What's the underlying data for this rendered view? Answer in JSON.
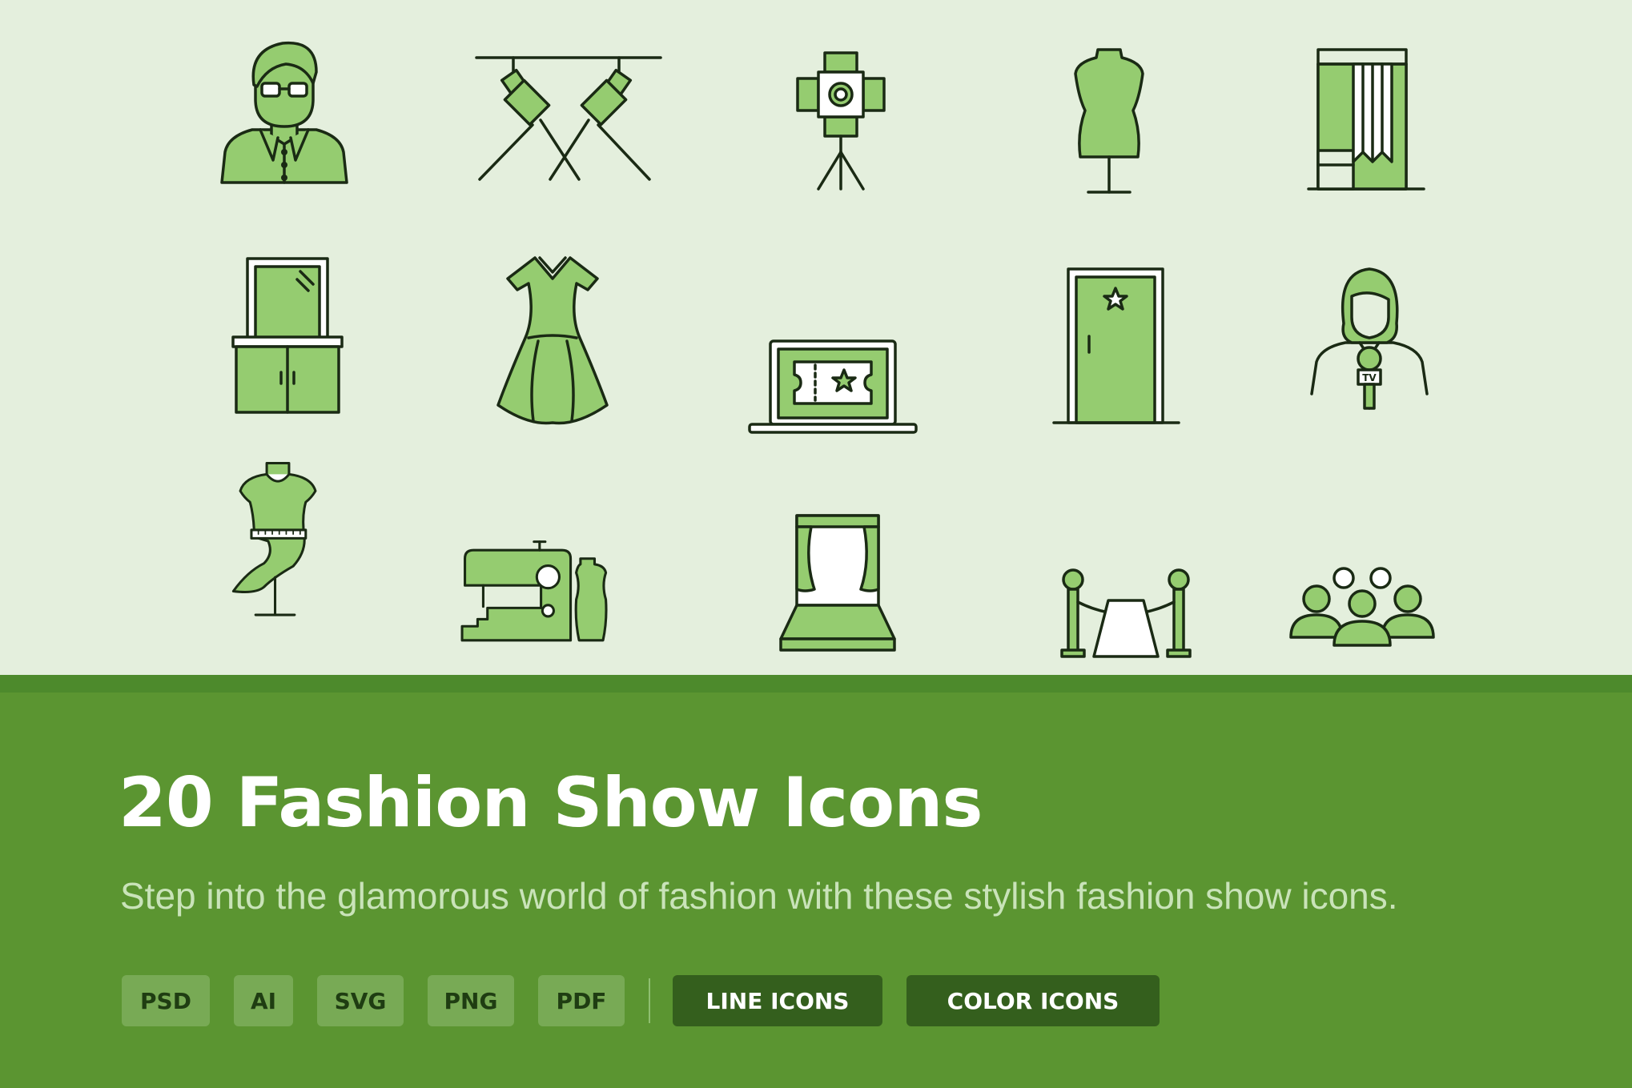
{
  "title": "20 Fashion Show Icons",
  "subtitle": "Step into the glamorous world of fashion with these stylish fashion show icons.",
  "formats": [
    "PSD",
    "AI",
    "SVG",
    "PNG",
    "PDF"
  ],
  "tags": [
    "LINE ICONS",
    "COLOR ICONS"
  ],
  "colors": {
    "top_background": "#e4efdd",
    "bottom_background": "#5b9531",
    "band": "#4d8a2c",
    "icon_fill": "#95cc70",
    "icon_stroke": "#1a2a14",
    "format_badge": "#78aa55",
    "tag_badge": "#345f1d",
    "title_text": "#ffffff",
    "subtitle_text": "#c9e3b9"
  },
  "icons": [
    "designer-man-icon",
    "spotlights-icon",
    "studio-light-icon",
    "dress-form-icon",
    "fitting-room-icon",
    "vanity-mirror-icon",
    "dress-icon",
    "laptop-ticket-icon",
    "star-door-icon",
    "tv-reporter-icon",
    "draped-mannequin-icon",
    "sewing-machine-icon",
    "runway-stage-icon",
    "velvet-rope-icon",
    "audience-icon"
  ]
}
